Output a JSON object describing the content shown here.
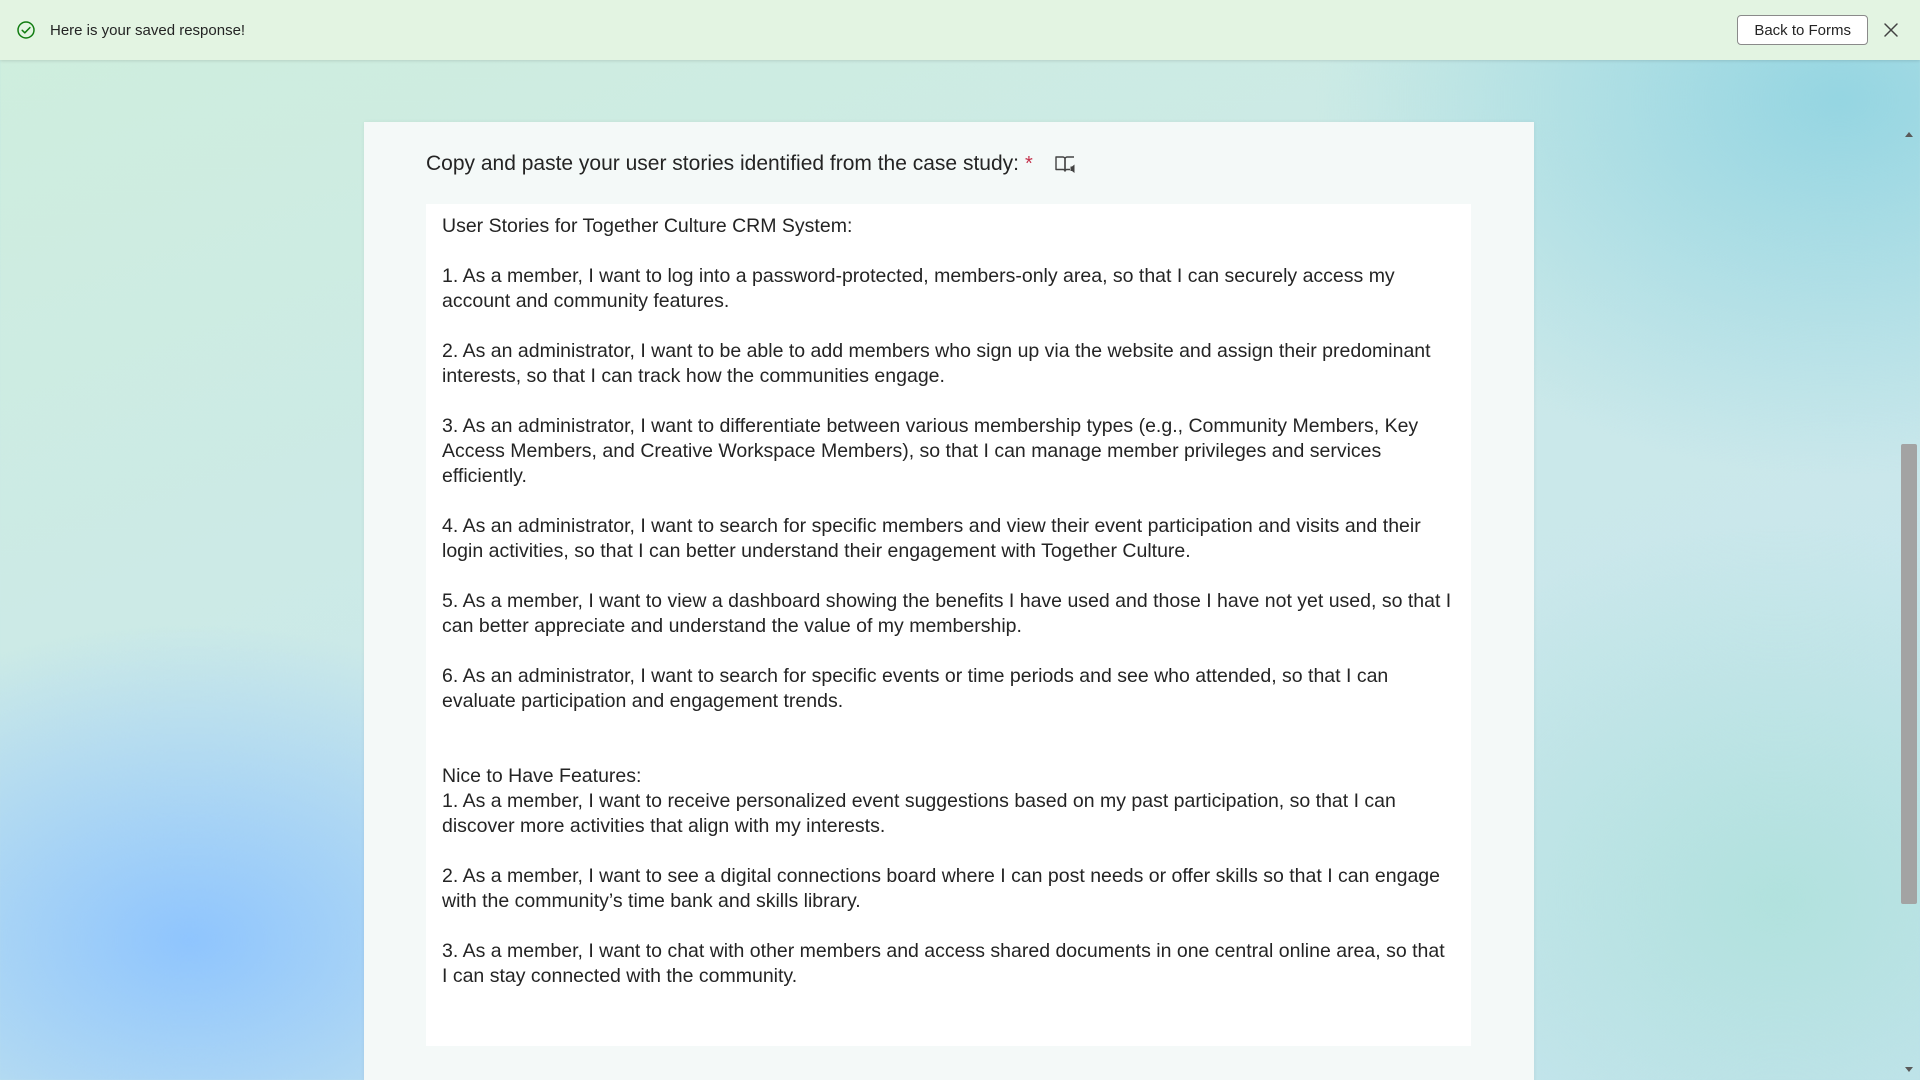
{
  "notification": {
    "message": "Here is your saved response!",
    "back_label": "Back to Forms",
    "icon": "check-circle-icon",
    "status_color": "#107c10"
  },
  "question": {
    "title": "Copy and paste your user stories identified from the case study:",
    "required_marker": "*",
    "reader_icon": "immersive-reader-icon"
  },
  "answer": {
    "text": "User Stories for Together Culture CRM System:\n\n1. As a member, I want to log into a password-protected, members-only area, so that I can securely access my account and community features.\n\n2. As an administrator, I want to be able to add members who sign up via the website and assign their predominant interests, so that I can track how the communities engage.\n\n3. As an administrator, I want to differentiate between various membership types (e.g., Community Members, Key Access Members, and Creative Workspace Members), so that I can manage member privileges and services efficiently.\n\n4. As an administrator, I want to search for specific members and view their event participation and visits and their login activities, so that I can better understand their engagement with Together Culture.\n\n5. As a member, I want to view a dashboard showing the benefits I have used and those I have not yet used, so that I can better appreciate and understand the value of my membership.\n\n6. As an administrator, I want to search for specific events or time periods and see who attended, so that I can evaluate participation and engagement trends.\n\n\nNice to Have Features:\n1. As a member, I want to receive personalized event suggestions based on my past participation, so that I can discover more activities that align with my interests.\n\n2. As a member, I want to see a digital connections board where I can post needs or offer skills so that I can engage with the community’s time bank and skills library.\n\n3. As a member, I want to chat with other members and access shared documents in one central online area, so that I can stay connected with the community."
  }
}
